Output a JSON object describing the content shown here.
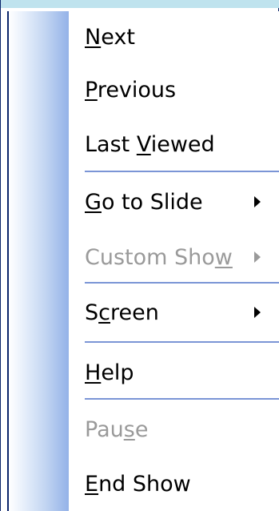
{
  "menu": {
    "items": [
      {
        "id": "next",
        "before": "",
        "accel": "N",
        "after": "ext",
        "disabled": false,
        "submenu": false
      },
      {
        "id": "previous",
        "before": "",
        "accel": "P",
        "after": "revious",
        "disabled": false,
        "submenu": false
      },
      {
        "id": "last-viewed",
        "before": "Last ",
        "accel": "V",
        "after": "iewed",
        "disabled": false,
        "submenu": false
      },
      {
        "id": "go-to-slide",
        "before": "",
        "accel": "G",
        "after": "o to Slide",
        "disabled": false,
        "submenu": true
      },
      {
        "id": "custom-show",
        "before": "Custom Sho",
        "accel": "w",
        "after": "",
        "disabled": true,
        "submenu": true
      },
      {
        "id": "screen",
        "before": "S",
        "accel": "c",
        "after": "reen",
        "disabled": false,
        "submenu": true
      },
      {
        "id": "help",
        "before": "",
        "accel": "H",
        "after": "elp",
        "disabled": false,
        "submenu": false
      },
      {
        "id": "pause",
        "before": "Pau",
        "accel": "s",
        "after": "e",
        "disabled": true,
        "submenu": false
      },
      {
        "id": "end-show",
        "before": "",
        "accel": "E",
        "after": "nd Show",
        "disabled": false,
        "submenu": false
      }
    ]
  },
  "colors": {
    "separator": "#7b95d6",
    "disabled_text": "#9a9a9a",
    "gutter_gradient_end": "#94b2e8",
    "frame": "#bfe3ee"
  }
}
